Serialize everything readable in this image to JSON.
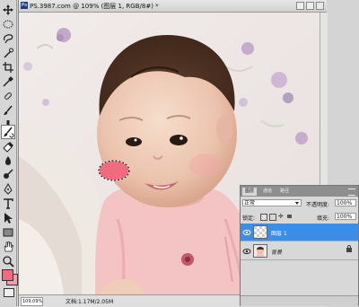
{
  "document": {
    "title": "PS.3987.com @ 109% (图层 1, RGB/8#) *",
    "zoom": "109.09%",
    "doc_size": "文档:1.17M/2.05M"
  },
  "colors": {
    "foreground": "#ee6b82",
    "background": "#f2a0aa",
    "blush": "#f06b80",
    "selection_accent": "#3b8de6"
  },
  "tools": [
    {
      "name": "move-tool-icon"
    },
    {
      "name": "marquee-tool-icon"
    },
    {
      "name": "lasso-tool-icon"
    },
    {
      "name": "quick-select-tool-icon"
    },
    {
      "name": "crop-tool-icon"
    },
    {
      "name": "eyedropper-tool-icon"
    },
    {
      "name": "healing-brush-tool-icon"
    },
    {
      "name": "brush-tool-icon"
    },
    {
      "name": "clone-stamp-tool-icon"
    },
    {
      "name": "history-brush-tool-icon"
    },
    {
      "name": "eraser-tool-icon"
    },
    {
      "name": "gradient-tool-icon"
    },
    {
      "name": "blur-tool-icon"
    },
    {
      "name": "dodge-tool-icon"
    },
    {
      "name": "pen-tool-icon"
    },
    {
      "name": "type-tool-icon"
    },
    {
      "name": "path-select-tool-icon"
    },
    {
      "name": "shape-tool-icon"
    },
    {
      "name": "hand-tool-icon"
    },
    {
      "name": "zoom-tool-icon"
    }
  ],
  "layers_panel": {
    "tabs": [
      "图层",
      "通道",
      "路径"
    ],
    "blend_mode": "正常",
    "opacity_label": "不透明度:",
    "opacity_value": "100%",
    "lock_label": "锁定:",
    "fill_label": "填充:",
    "fill_value": "100%",
    "layers": [
      {
        "name": "图层 1",
        "selected": true
      },
      {
        "name": "背景",
        "selected": false,
        "locked": true
      }
    ]
  }
}
